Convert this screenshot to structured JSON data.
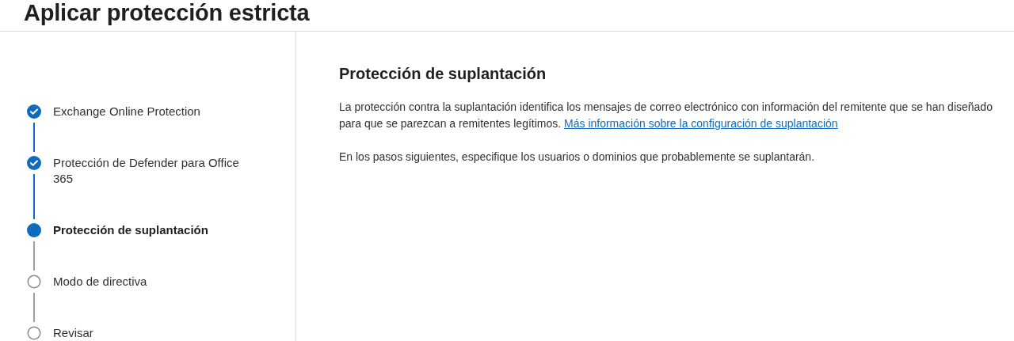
{
  "page": {
    "title": "Aplicar protección estricta"
  },
  "steps": [
    {
      "label": "Exchange Online Protection",
      "completed": true,
      "selected": false
    },
    {
      "label": "Protección de Defender para Office 365",
      "completed": true,
      "selected": false
    },
    {
      "label": "Protección de suplantación",
      "completed": false,
      "selected": true
    },
    {
      "label": "Modo de directiva",
      "completed": false,
      "selected": false
    },
    {
      "label": "Revisar",
      "completed": false,
      "selected": false
    }
  ],
  "content": {
    "heading": "Protección de suplantación",
    "description": "La protección contra la suplantación identifica los mensajes de correo electrónico con información del remitente que se han diseñado para que se parezcan a remitentes legítimos.",
    "link": "Más información sobre la configuración de suplantación",
    "note": "En los pasos siguientes, especifique los usuarios o dominios que probablemente se suplantarán."
  }
}
